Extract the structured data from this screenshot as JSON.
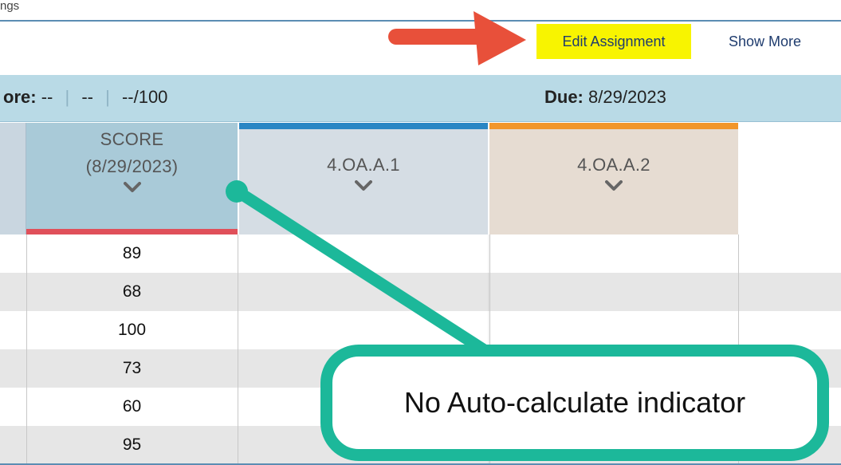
{
  "breadcrumb": "ngs",
  "header": {
    "edit_assignment": "Edit Assignment",
    "show_more": "Show More"
  },
  "info_bar": {
    "score_label": "ore:",
    "score_value": "--",
    "part2": "--",
    "part3": "--/100",
    "due_label": "Due:",
    "due_value": "8/29/2023"
  },
  "columns": {
    "score_title": "SCORE",
    "score_date": "(8/29/2023)",
    "standard1": "4.OA.A.1",
    "standard2": "4.OA.A.2"
  },
  "scores": [
    "89",
    "68",
    "100",
    "73",
    "60",
    "95"
  ],
  "annotation": {
    "callout_text": "No Auto-calculate indicator",
    "arrow_color": "#e8503a",
    "pointer_color": "#1cb89a",
    "highlight_color": "#f8f400"
  },
  "colors": {
    "score_bar": "#e0505a",
    "standard1_bar": "#2a86c4",
    "standard2_bar": "#f2962a"
  }
}
